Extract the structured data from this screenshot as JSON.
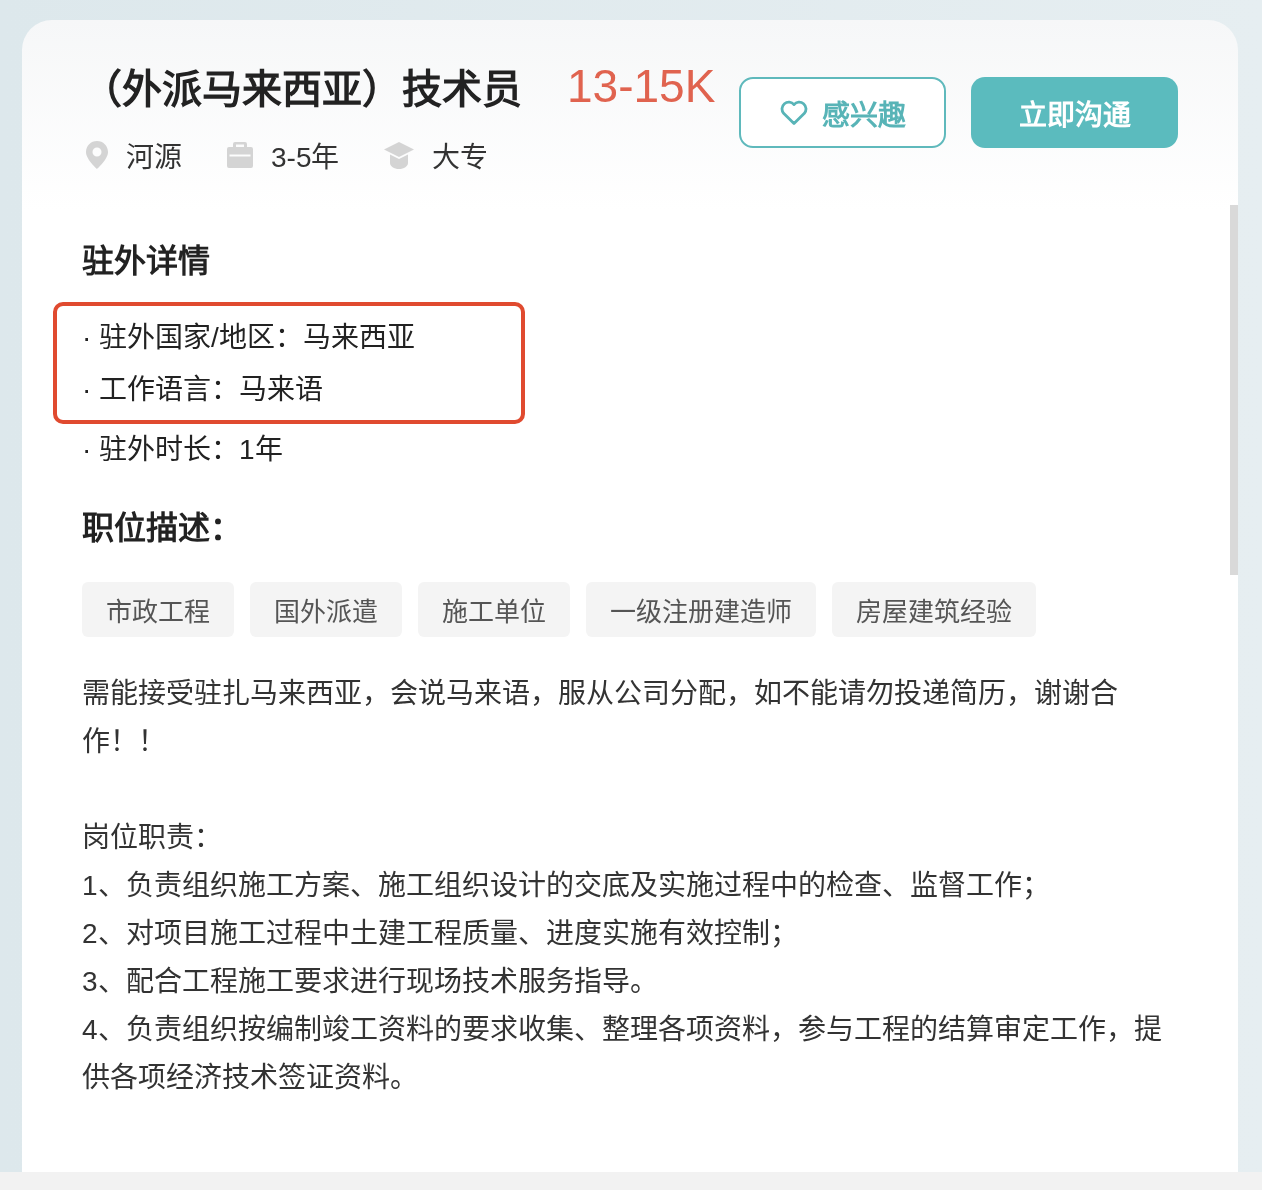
{
  "job": {
    "title": "（外派马来西亚）技术员",
    "salary": "13-15K",
    "meta": [
      {
        "kind": "location",
        "text": "河源"
      },
      {
        "kind": "experience",
        "text": "3-5年"
      },
      {
        "kind": "education",
        "text": "大专"
      }
    ]
  },
  "actions": [
    {
      "kind": "outline",
      "label": "感兴趣"
    },
    {
      "kind": "primary",
      "label": "立即沟通"
    }
  ],
  "assignment": {
    "heading": "驻外详情",
    "items": [
      {
        "text": "· 驻外国家/地区：马来西亚",
        "highlighted": true
      },
      {
        "text": "· 工作语言：马来语",
        "highlighted": true
      },
      {
        "text": "· 驻外时长：1年",
        "highlighted": false
      }
    ]
  },
  "description": {
    "heading": "职位描述：",
    "tags": [
      "市政工程",
      "国外派遣",
      "施工单位",
      "一级注册建造师",
      "房屋建筑经验"
    ],
    "intro": "需能接受驻扎马来西亚，会说马来语，服从公司分配，如不能请勿投递简历，谢谢合作！！",
    "duties_heading": "岗位职责：",
    "duties": [
      "1、负责组织施工方案、施工组织设计的交底及实施过程中的检查、监督工作；",
      "2、对项目施工过程中土建工程质量、进度实施有效控制；",
      "3、配合工程施工要求进行现场技术服务指导。",
      "4、负责组织按编制竣工资料的要求收集、整理各项资料，参与工程的结算审定工作，提供各项经济技术签证资料。"
    ]
  }
}
